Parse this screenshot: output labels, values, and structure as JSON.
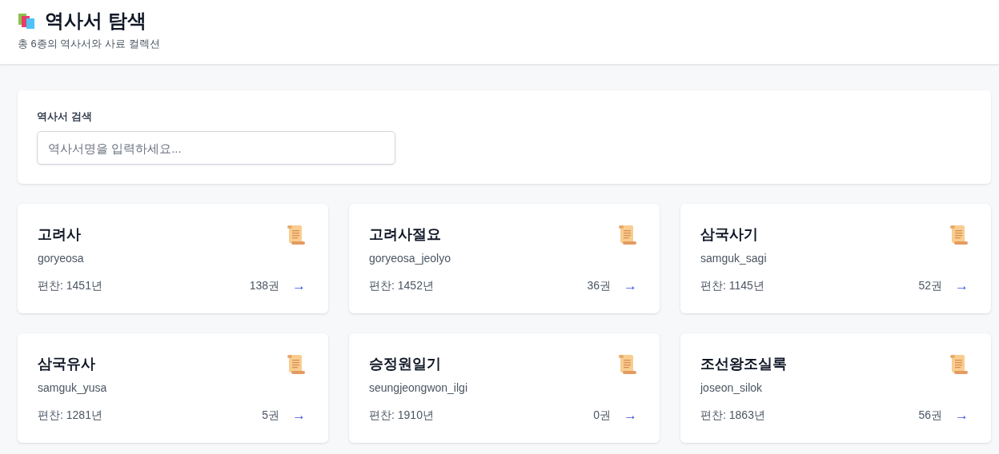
{
  "header": {
    "title": "역사서 탐색",
    "subtitle": "총 6종의 역사서와 사료 컬렉션"
  },
  "search": {
    "label": "역사서 검색",
    "placeholder": "역사서명을 입력하세요..."
  },
  "books": [
    {
      "name": "고려사",
      "code": "goryeosa",
      "compiled": "편찬: 1451년",
      "volumes": "138권",
      "arrow": "→"
    },
    {
      "name": "고려사절요",
      "code": "goryeosa_jeolyo",
      "compiled": "편찬: 1452년",
      "volumes": "36권",
      "arrow": "→"
    },
    {
      "name": "삼국사기",
      "code": "samguk_sagi",
      "compiled": "편찬: 1145년",
      "volumes": "52권",
      "arrow": "→"
    },
    {
      "name": "삼국유사",
      "code": "samguk_yusa",
      "compiled": "편찬: 1281년",
      "volumes": "5권",
      "arrow": "→"
    },
    {
      "name": "승정원일기",
      "code": "seungjeongwon_ilgi",
      "compiled": "편찬: 1910년",
      "volumes": "0권",
      "arrow": "→"
    },
    {
      "name": "조선왕조실록",
      "code": "joseon_silok",
      "compiled": "편찬: 1863년",
      "volumes": "56권",
      "arrow": "→"
    }
  ]
}
